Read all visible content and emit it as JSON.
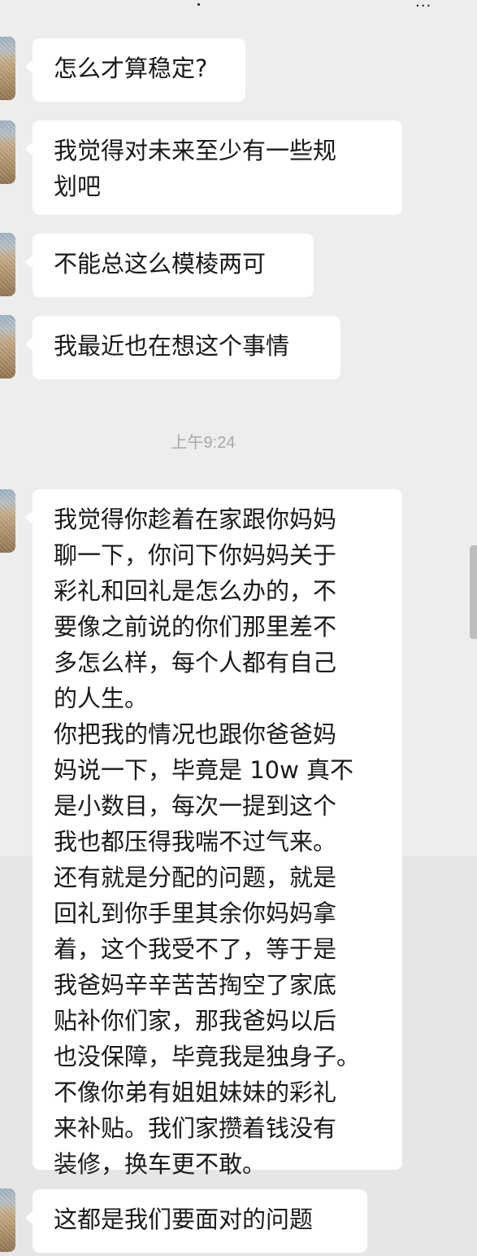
{
  "top_bar": {
    "dot": ".",
    "more": "..."
  },
  "timestamp": "上午9:24",
  "messages": [
    {
      "text": "怎么才算稳定?"
    },
    {
      "text": "我觉得对未来至少有一些规\n划吧"
    },
    {
      "text": "不能总这么模棱两可"
    },
    {
      "text": "我最近也在想这个事情"
    },
    {
      "text": "我觉得你趁着在家跟你妈妈\n聊一下，你问下你妈妈关于\n彩礼和回礼是怎么办的，不\n要像之前说的你们那里差不\n多怎么样，每个人都有自己\n的人生。\n你把我的情况也跟你爸爸妈\n妈说一下，毕竟是 10w 真不\n是小数目，每次一提到这个\n我也都压得我喘不过气来。\n还有就是分配的问题，就是\n回礼到你手里其余你妈妈拿\n着，这个我受不了，等于是\n我爸妈辛辛苦苦掏空了家底\n贴补你们家，那我爸妈以后\n也没保障，毕竟我是独身子。\n不像你弟有姐姐妹妹的彩礼\n来补贴。我们家攒着钱没有\n装修，换车更不敢。"
    },
    {
      "text": "这都是我们要面对的问题"
    }
  ]
}
